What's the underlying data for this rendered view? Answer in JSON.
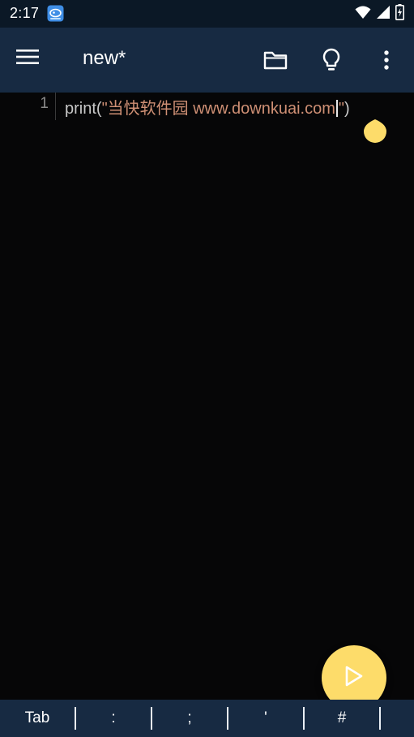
{
  "status_bar": {
    "time": "2:17",
    "icons": [
      "app-notification-icon",
      "wifi-icon",
      "signal-icon",
      "battery-charging-icon"
    ]
  },
  "app_bar": {
    "menu_icon": "hamburger-menu-icon",
    "title": "new*",
    "actions": [
      "folder-icon",
      "lightbulb-icon",
      "more-vert-icon"
    ]
  },
  "editor": {
    "lines": [
      {
        "number": "1",
        "tokens": {
          "fn": "print",
          "open": "(",
          "str_before_cursor": "\"当快软件园 www.downkuai.com",
          "str_after_cursor": "\"",
          "close": ")"
        }
      }
    ],
    "colors": {
      "background": "#060607",
      "text": "#c8c8c8",
      "string": "#ce8f74",
      "cursor_handle": "#fddc6a"
    }
  },
  "run_button": {
    "icon": "play-icon",
    "color": "#fddc6a"
  },
  "symbol_bar": {
    "keys": [
      "Tab",
      ":",
      ";",
      "'",
      "#",
      "("
    ]
  },
  "theme": {
    "app_bar": "#172a42",
    "status_bar": "#0b1826"
  }
}
